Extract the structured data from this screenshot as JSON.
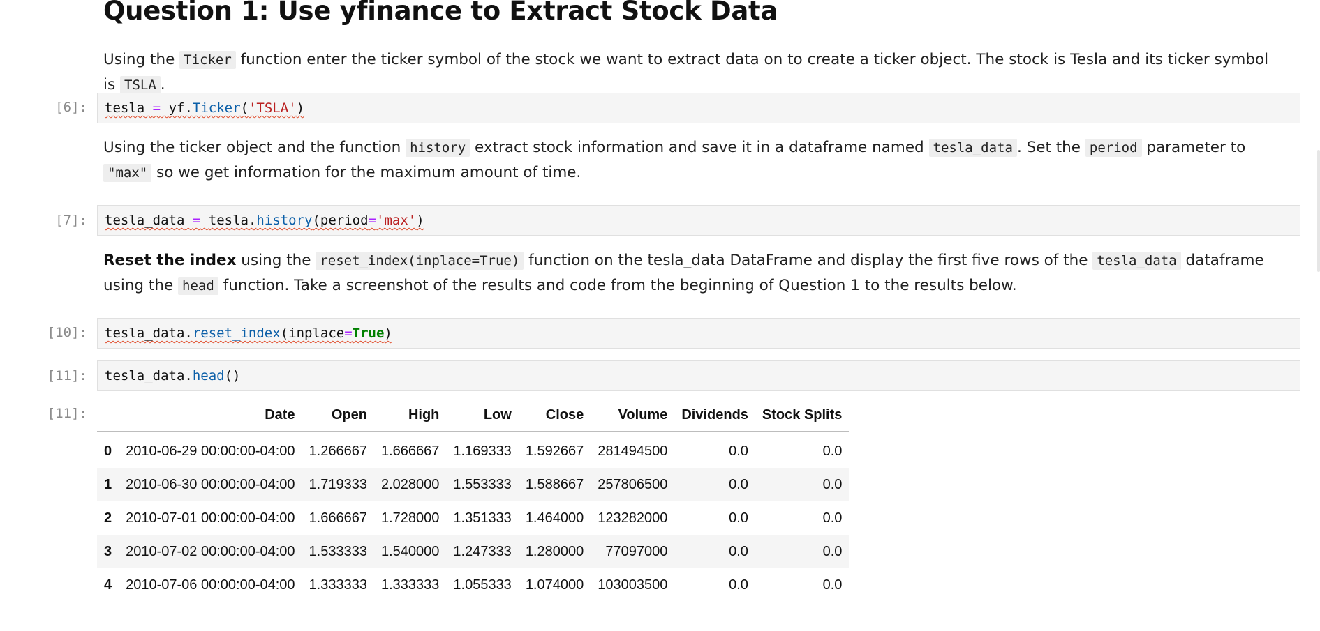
{
  "heading": "Question 1: Use yfinance to Extract Stock Data",
  "md1": {
    "t1": "Using the ",
    "c1": "Ticker",
    "t2": " function enter the ticker symbol of the stock we want to extract data on to create a ticker object. The stock is Tesla and its ticker symbol is ",
    "c2": "TSLA",
    "t3": "."
  },
  "md2": {
    "t1": "Using the ticker object and the function ",
    "c1": "history",
    "t2": " extract stock information and save it in a dataframe named ",
    "c2": "tesla_data",
    "t3": ". Set the ",
    "c3": "period",
    "t4": " parameter to ",
    "c4": "\"max\"",
    "t5": " so we get information for the maximum amount of time."
  },
  "md3": {
    "b1": "Reset the index",
    "t1": " using the ",
    "c1": "reset_index(inplace=True)",
    "t2": " function on the tesla_data DataFrame and display the first five rows of the ",
    "c2": "tesla_data",
    "t3": " dataframe using the ",
    "c3": "head",
    "t4": " function. Take a screenshot of the results and code from the beginning of Question 1 to the results below."
  },
  "cells": {
    "c6": {
      "prompt": "[6]:",
      "var": "tesla",
      "op": "=",
      "obj": "yf.",
      "fn": "Ticker",
      "open": "(",
      "str": "'TSLA'",
      "close": ")"
    },
    "c7": {
      "prompt": "[7]:",
      "var": "tesla_data",
      "op": "=",
      "obj": "tesla.",
      "fn": "history",
      "open": "(period",
      "eq": "=",
      "str": "'max'",
      "close": ")"
    },
    "c10": {
      "prompt": "[10]:",
      "obj": "tesla_data.",
      "fn": "reset_index",
      "open": "(inplace",
      "eq": "=",
      "kw": "True",
      "close": ")"
    },
    "c11": {
      "prompt": "[11]:",
      "obj": "tesla_data.",
      "fn": "head",
      "call": "()"
    },
    "out11": {
      "prompt": "[11]:"
    }
  },
  "table": {
    "columns": [
      "",
      "Date",
      "Open",
      "High",
      "Low",
      "Close",
      "Volume",
      "Dividends",
      "Stock Splits"
    ],
    "rows": [
      [
        "0",
        "2010-06-29 00:00:00-04:00",
        "1.266667",
        "1.666667",
        "1.169333",
        "1.592667",
        "281494500",
        "0.0",
        "0.0"
      ],
      [
        "1",
        "2010-06-30 00:00:00-04:00",
        "1.719333",
        "2.028000",
        "1.553333",
        "1.588667",
        "257806500",
        "0.0",
        "0.0"
      ],
      [
        "2",
        "2010-07-01 00:00:00-04:00",
        "1.666667",
        "1.728000",
        "1.351333",
        "1.464000",
        "123282000",
        "0.0",
        "0.0"
      ],
      [
        "3",
        "2010-07-02 00:00:00-04:00",
        "1.533333",
        "1.540000",
        "1.247333",
        "1.280000",
        "77097000",
        "0.0",
        "0.0"
      ],
      [
        "4",
        "2010-07-06 00:00:00-04:00",
        "1.333333",
        "1.333333",
        "1.055333",
        "1.074000",
        "103003500",
        "0.0",
        "0.0"
      ]
    ]
  },
  "colors": {
    "operator": "#aa22ff",
    "function": "#0b5fa8",
    "string": "#ba2121",
    "keyword": "#008000",
    "prompt": "#8a8a8a",
    "cell_bg": "#f5f5f5"
  }
}
